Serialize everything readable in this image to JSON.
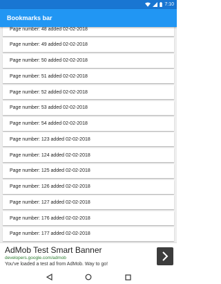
{
  "status_bar": {
    "time": "7:10"
  },
  "app_bar": {
    "title": "Bookmarks bar"
  },
  "bookmarks": [
    {
      "label": "Page number: 48 added 02-02-2018"
    },
    {
      "label": "Page number: 49 added 02-02-2018"
    },
    {
      "label": "Page number: 50 added 02-02-2018"
    },
    {
      "label": "Page number: 51 added 02-02-2018"
    },
    {
      "label": "Page number: 52 added 02-02-2018"
    },
    {
      "label": "Page number: 53 added 02-02-2018"
    },
    {
      "label": "Page number: 54 added 02-02-2018"
    },
    {
      "label": "Page number: 123 added 02-02-2018"
    },
    {
      "label": "Page number: 124 added 02-02-2018"
    },
    {
      "label": "Page number: 125 added 02-02-2018"
    },
    {
      "label": "Page number: 126 added 02-02-2018"
    },
    {
      "label": "Page number: 127 added 02-02-2018"
    },
    {
      "label": "Page number: 176 added 02-02-2018"
    },
    {
      "label": "Page number: 177 added 02-02-2018"
    }
  ],
  "ad": {
    "title": "AdMob Test Smart Banner",
    "url": "developers.google.com/admob",
    "description": "You've loaded a test ad from AdMob. Way to go!",
    "arrow_icon": "chevron-right-icon"
  },
  "nav": {
    "back_icon": "back-triangle-icon",
    "home_icon": "home-circle-icon",
    "recents_icon": "recents-square-icon"
  },
  "colors": {
    "status_bar": "#1976d2",
    "app_bar": "#2196f3",
    "list_background": "#eeeeee",
    "ad_url": "#2e7d32"
  }
}
